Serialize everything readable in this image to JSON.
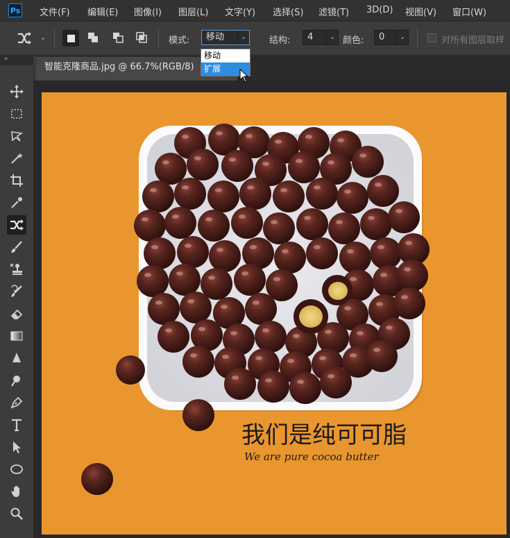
{
  "app": {
    "logo_text": "Ps"
  },
  "menu": [
    {
      "label": "文件(F)"
    },
    {
      "label": "编辑(E)"
    },
    {
      "label": "图像(I)"
    },
    {
      "label": "图层(L)"
    },
    {
      "label": "文字(Y)"
    },
    {
      "label": "选择(S)"
    },
    {
      "label": "滤镜(T)"
    },
    {
      "label": "3D(D)"
    },
    {
      "label": "视图(V)"
    },
    {
      "label": "窗口(W)"
    }
  ],
  "options": {
    "tool_icon": "content-aware-move-icon",
    "mode_label": "模式:",
    "mode_value": "移动",
    "structure_label": "结构:",
    "structure_value": "4",
    "color_label": "颜色:",
    "color_value": "0",
    "sample_all_label": "对所有图层取样"
  },
  "mode_dropdown": {
    "options": [
      "移动",
      "扩展"
    ],
    "highlighted": "扩展"
  },
  "document": {
    "tab_title": "智能克隆商品.jpg @ 66.7%(RGB/8)"
  },
  "canvas": {
    "background_color": "#ea962f",
    "headline": "我们是纯可可脂",
    "subline": "We are pure cocoa butter"
  },
  "tools": [
    "move-icon",
    "marquee-icon",
    "lasso-icon",
    "magic-wand-icon",
    "crop-icon",
    "eyedropper-icon",
    "content-aware-move-icon",
    "brush-icon",
    "clone-stamp-icon",
    "history-brush-icon",
    "eraser-icon",
    "gradient-icon",
    "blur-icon",
    "dodge-icon",
    "pen-icon",
    "type-icon",
    "path-selection-icon",
    "ellipse-icon",
    "hand-icon",
    "zoom-icon"
  ]
}
